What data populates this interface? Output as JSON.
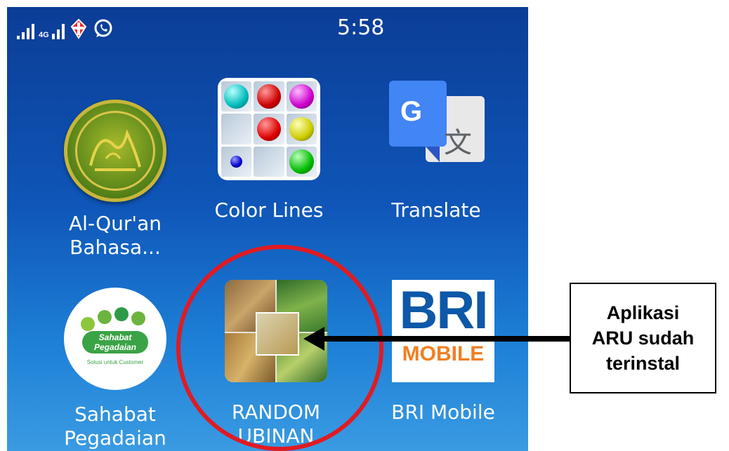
{
  "status_bar": {
    "network_label": "4G",
    "time": "5:58"
  },
  "apps": {
    "quran": {
      "label_line1": "Al-Qur'an",
      "label_line2": "Bahasa..."
    },
    "color_lines": {
      "label": "Color Lines"
    },
    "translate": {
      "label": "Translate",
      "icon_letter": "G",
      "icon_glyph": "文"
    },
    "sahabat": {
      "label_line1": "Sahabat",
      "label_line2": "Pegadaian",
      "icon_text_line1": "Sahabat",
      "icon_text_line2": "Pegadaian",
      "icon_tagline": "Solusi untuk Customer"
    },
    "random_ubinan": {
      "label_line1": "RANDOM",
      "label_line2": "UBINAN"
    },
    "bri_mobile": {
      "label": "BRI Mobile",
      "icon_text_big": "BRI",
      "icon_text_small": "MOBILE"
    }
  },
  "annotation": {
    "line1": "Aplikasi",
    "line2": "ARU sudah",
    "line3": "terinstal"
  },
  "colors": {
    "screen_top": "#0b3d96",
    "screen_bottom": "#3a9be2",
    "highlight_circle": "#e11a22",
    "arrow": "#000000"
  },
  "icons": [
    "signal-icon",
    "signal-4g-icon",
    "telkomsel-icon",
    "whatsapp-icon"
  ]
}
